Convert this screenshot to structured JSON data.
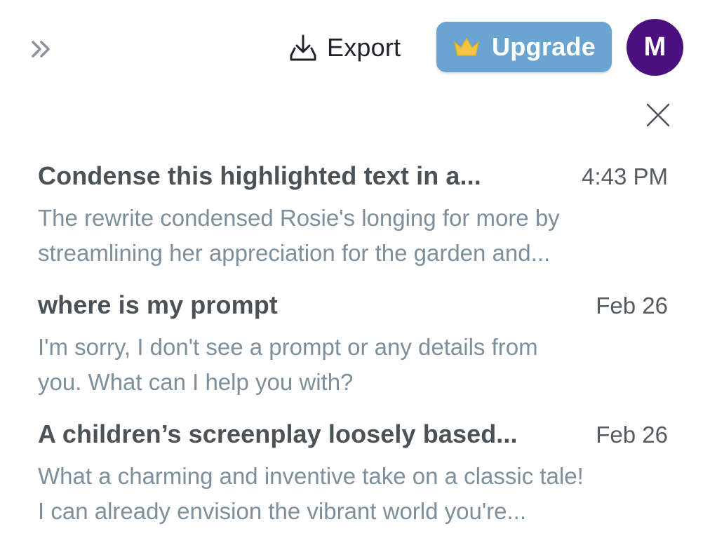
{
  "header": {
    "export_label": "Export",
    "upgrade_label": "Upgrade",
    "avatar_letter": "M"
  },
  "colors": {
    "upgrade_bg": "#6aa5d2",
    "avatar_bg": "#4b0f7f",
    "crown": "#f5c542",
    "title_text": "#4b5257",
    "preview_text": "#7c8f9a"
  },
  "icons": {
    "expand": "double-chevron-right-icon",
    "export": "download-tray-icon",
    "upgrade": "crown-icon",
    "close": "close-icon"
  },
  "conversations": [
    {
      "title": "Condense this highlighted text in a...",
      "time": "4:43 PM",
      "preview_lines": [
        "The rewrite condensed Rosie's longing for more by",
        "streamlining her appreciation for the garden and..."
      ]
    },
    {
      "title": "where is my prompt",
      "time": "Feb 26",
      "preview_lines": [
        "I'm sorry, I don't see a prompt or any details from",
        "you. What can I help you with?"
      ]
    },
    {
      "title": "A children’s screenplay loosely based...",
      "time": "Feb 26",
      "preview_lines": [
        "What a charming and inventive take on a classic tale!",
        "I can already envision the vibrant world you're..."
      ]
    }
  ]
}
